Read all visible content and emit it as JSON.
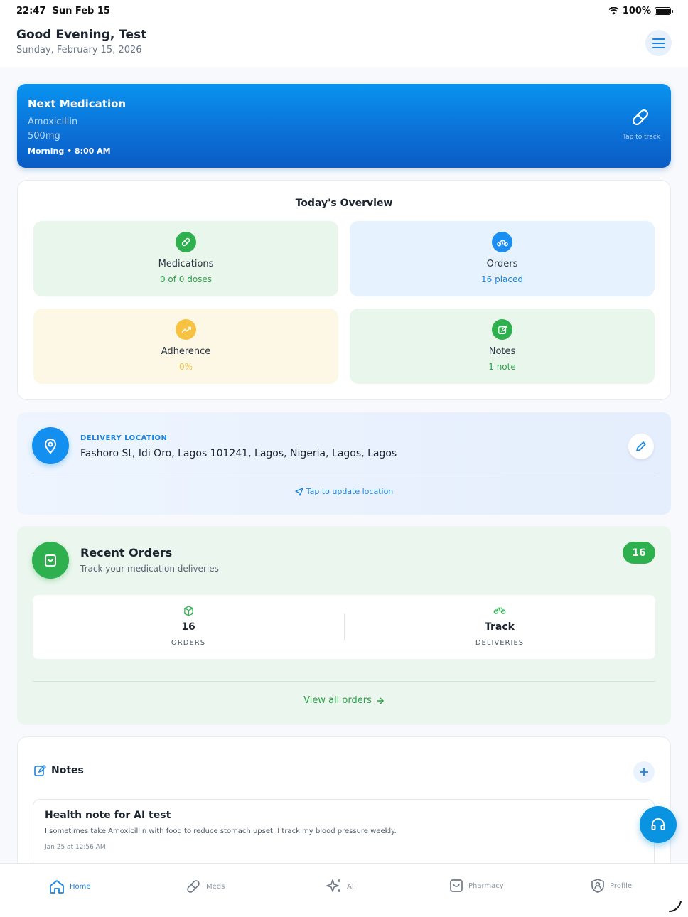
{
  "status": {
    "time": "22:47",
    "date": "Sun Feb 15",
    "battery": "100%"
  },
  "header": {
    "greeting": "Good Evening, Test",
    "date": "Sunday, February 15, 2026"
  },
  "next_medication": {
    "title": "Next Medication",
    "drug": "Amoxicillin",
    "dose": "500mg",
    "schedule": "Morning • 8:00 AM",
    "action": "Tap to track"
  },
  "overview": {
    "title": "Today's Overview",
    "tiles": [
      {
        "label": "Medications",
        "value": "0 of 0 doses",
        "icon": "pill-icon",
        "color": "#2fb04f"
      },
      {
        "label": "Orders",
        "value": "16 placed",
        "icon": "bike-icon",
        "color": "#1b8ef2"
      },
      {
        "label": "Adherence",
        "value": "0%",
        "icon": "trend-up-icon",
        "color": "#f7c242"
      },
      {
        "label": "Notes",
        "value": "1 note",
        "icon": "edit-note-icon",
        "color": "#2fb04f"
      }
    ]
  },
  "delivery": {
    "caption": "DELIVERY LOCATION",
    "address": "Fashoro St, Idi Oro, Lagos 101241, Lagos, Nigeria, Lagos, Lagos",
    "update_label": "Tap to update location"
  },
  "recent_orders": {
    "title": "Recent Orders",
    "subtitle": "Track your medication deliveries",
    "badge": "16",
    "stats": [
      {
        "value": "16",
        "caption": "ORDERS",
        "icon": "box-icon"
      },
      {
        "value": "Track",
        "caption": "DELIVERIES",
        "icon": "bike-icon"
      }
    ],
    "view_all": "View all orders"
  },
  "notes": {
    "title": "Notes",
    "items": [
      {
        "title": "Health note for AI test",
        "body": "I sometimes take Amoxicillin with food to reduce stomach upset. I track my blood pressure weekly.",
        "date": "Jan 25 at 12:56 AM"
      }
    ]
  },
  "tabbar": {
    "tabs": [
      {
        "label": "Home",
        "icon": "home-icon",
        "active": true
      },
      {
        "label": "Meds",
        "icon": "pill-icon",
        "active": false
      },
      {
        "label": "AI",
        "icon": "sparkle-icon",
        "active": false
      },
      {
        "label": "Pharmacy",
        "icon": "bag-icon",
        "active": false
      },
      {
        "label": "Profile",
        "icon": "shield-user-icon",
        "active": false
      }
    ]
  },
  "colors": {
    "primary": "#0b6fd6",
    "success": "#2fb04f",
    "warning": "#f7c242",
    "accent": "#1b84e0"
  }
}
